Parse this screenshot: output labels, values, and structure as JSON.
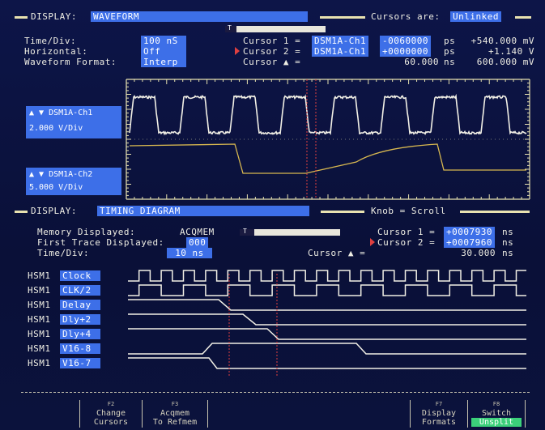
{
  "top": {
    "display_label": "DISPLAY:",
    "display_mode": "WAVEFORM",
    "cursors_label": "Cursors are:",
    "cursors_mode": "Unlinked",
    "time_div_label": "Time/Div:",
    "time_div_value": "100 nS",
    "horizontal_label": "Horizontal:",
    "horizontal_value": "Off",
    "format_label": "Waveform Format:",
    "format_value": "Interp",
    "cursor1_label": "Cursor 1 =",
    "cursor1_chan": "DSM1A-Ch1",
    "cursor1_time": "-0060000",
    "cursor1_unit": "ps",
    "cursor1_volt": "+540.000 mV",
    "cursor2_label": "Cursor 2 =",
    "cursor2_chan": "DSM1A-Ch1",
    "cursor2_time": "+0000000",
    "cursor2_unit": "ps",
    "cursor2_volt": "+1.140 V",
    "cursor_delta_label": "Cursor ▲ =",
    "cursor_delta_time": "60.000",
    "cursor_delta_unit": "ns",
    "cursor_delta_volt": "600.000 mV",
    "scroll_mark": "T"
  },
  "channels": [
    {
      "name": "▲ ▼  DSM1A-Ch1",
      "scale": "2.000 V/Div"
    },
    {
      "name": "▲ ▼  DSM1A-Ch2",
      "scale": "5.000 V/Div"
    }
  ],
  "timing": {
    "display_label": "DISPLAY:",
    "display_mode": "TIMING DIAGRAM",
    "knob_label": "Knob = Scroll",
    "mem_label": "Memory Displayed:",
    "mem_value": "ACQMEM",
    "first_label": "First Trace Displayed:",
    "first_value": "000",
    "time_div_label": "Time/Div:",
    "time_div_value": "10 ns",
    "cursor1_label": "Cursor 1 =",
    "cursor1_value": "+0007930",
    "cursor1_unit": "ns",
    "cursor2_label": "Cursor 2 =",
    "cursor2_value": "+0007960",
    "cursor2_unit": "ns",
    "cursor_delta_label": "Cursor ▲ =",
    "cursor_delta_value": "30.000",
    "cursor_delta_unit": "ns",
    "scroll_mark": "T",
    "traces": [
      {
        "prefix": "HSM1",
        "label": "Clock"
      },
      {
        "prefix": "HSM1",
        "label": "CLK/2"
      },
      {
        "prefix": "HSM1",
        "label": "Delay"
      },
      {
        "prefix": "HSM1",
        "label": "Dly+2"
      },
      {
        "prefix": "HSM1",
        "label": "Dly+4"
      },
      {
        "prefix": "HSM1",
        "label": "V16-8"
      },
      {
        "prefix": "HSM1",
        "label": "V16-7"
      }
    ]
  },
  "softkeys": [
    {
      "key": "F2",
      "line1": "Change",
      "line2": "Cursors"
    },
    {
      "key": "F3",
      "line1": "Acqmem",
      "line2": "To Refmem"
    },
    {
      "key": "F7",
      "line1": "Display",
      "line2": "Formats"
    },
    {
      "key": "F8",
      "line1": "Switch",
      "line2": "Unsplit"
    }
  ],
  "colors": {
    "background": "#0b1240",
    "highlight": "#3d6fe8",
    "trace_white": "#f2f0e6",
    "trace_yellow": "#d8b850",
    "cursor_red": "#e04040",
    "active_key": "#3bd07a"
  }
}
